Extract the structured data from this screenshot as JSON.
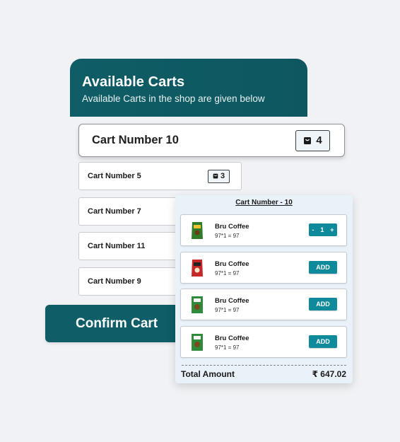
{
  "header": {
    "title": "Available Carts",
    "subtitle": "Available Carts in the shop are given below"
  },
  "selected_cart": {
    "label": "Cart Number 10",
    "count": "4"
  },
  "carts": [
    {
      "label": "Cart Number 5",
      "count": "3"
    },
    {
      "label": "Cart Number 7"
    },
    {
      "label": "Cart Number 11"
    },
    {
      "label": "Cart Number 9"
    }
  ],
  "confirm_label": "Confirm Cart",
  "panel": {
    "title": "Cart Number - 10",
    "items": [
      {
        "name": "Bru Coffee",
        "price": "97*1 = 97",
        "quantity": "1",
        "minus": "-",
        "plus": "+",
        "package_color": "#2f7d2a"
      },
      {
        "name": "Bru Coffee",
        "price": "97*1 = 97",
        "action": "ADD",
        "package_color": "#c62828"
      },
      {
        "name": "Bru Coffee",
        "price": "97*1 = 97",
        "action": "ADD",
        "package_color": "#2e8b3a"
      },
      {
        "name": "Bru Coffee",
        "price": "97*1 = 97",
        "action": "ADD",
        "package_color": "#2e8b3a"
      }
    ],
    "total_label": "Total Amount",
    "total_value": "₹ 647.02"
  },
  "colors": {
    "primary": "#0f5d66",
    "button": "#0f8a9b",
    "panel_bg": "#e9f2f9",
    "page_bg": "#f0f2f5"
  }
}
